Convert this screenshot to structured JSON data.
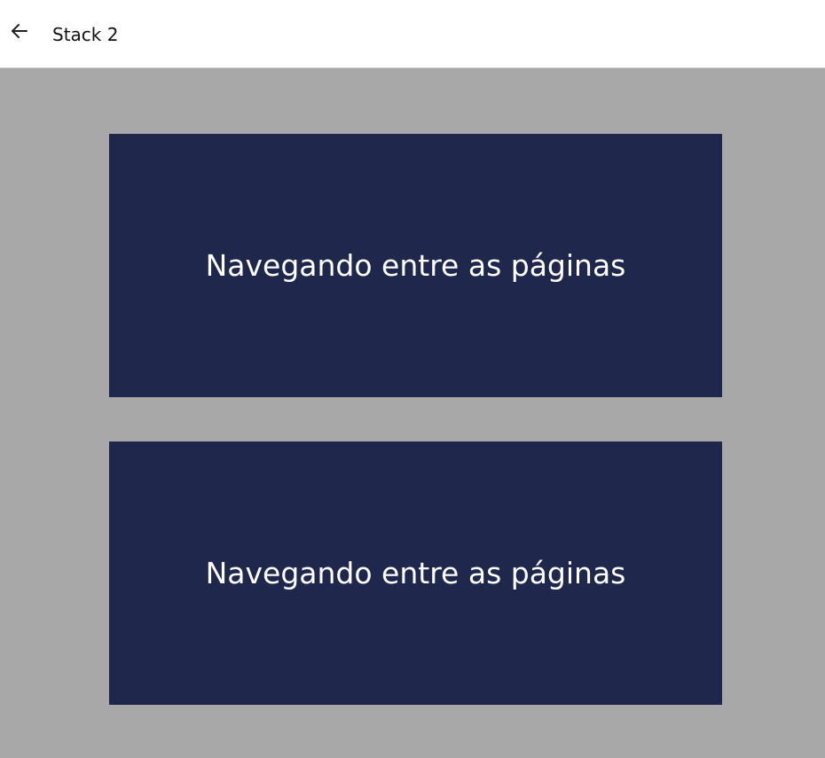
{
  "header": {
    "back_icon": "arrow-left-icon",
    "title": "Stack 2"
  },
  "cards": [
    {
      "label": "Navegando entre as páginas"
    },
    {
      "label": "Navegando entre as páginas"
    }
  ],
  "colors": {
    "header_background": "#ffffff",
    "page_background": "#a8a8a8",
    "card_background": "#1f284c",
    "card_text": "#ffffff"
  }
}
